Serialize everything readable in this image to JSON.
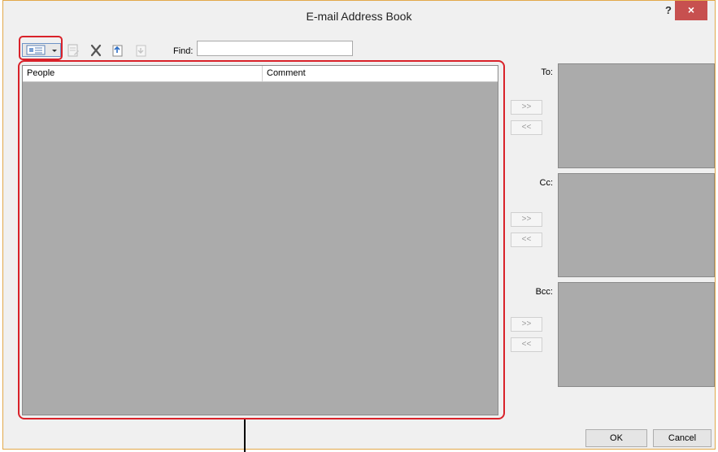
{
  "window": {
    "title": "E-mail Address Book",
    "help_label": "?",
    "close_label": "×"
  },
  "toolbar": {
    "icons": [
      "view-icon",
      "edit-icon",
      "delete-icon",
      "import-icon",
      "export-icon"
    ],
    "find_label": "Find:",
    "find_value": ""
  },
  "list": {
    "columns": [
      "People",
      "Comment"
    ]
  },
  "recipients": {
    "to_label": "To:",
    "cc_label": "Cc:",
    "bcc_label": "Bcc:",
    "add_label": ">>",
    "remove_label": "<<"
  },
  "buttons": {
    "ok": "OK",
    "cancel": "Cancel"
  },
  "colors": {
    "highlight": "#d9222a",
    "list_bg": "#ababab",
    "close_bg": "#c7504f"
  }
}
